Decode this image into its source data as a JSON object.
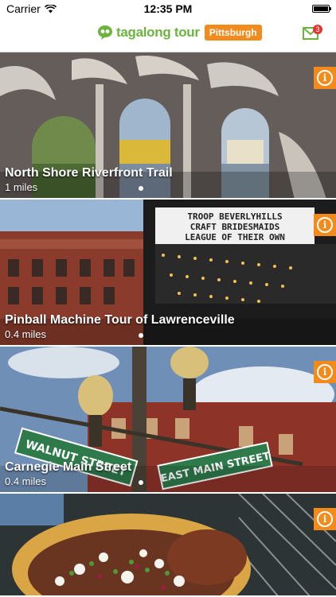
{
  "status_bar": {
    "carrier": "Carrier",
    "time": "12:35 PM",
    "battery_level": 1.0
  },
  "header": {
    "logo_text": "tagalong tour",
    "city": "Pittsburgh",
    "mail_count": "3"
  },
  "colors": {
    "brand_green": "#6cb43f",
    "accent_orange": "#f28a1c",
    "badge_red": "#e3342f"
  },
  "tours": [
    {
      "title": "North Shore Riverfront Trail",
      "distance": "1 miles",
      "info_icon": "info-icon"
    },
    {
      "title": "Pinball Machine Tour of Lawrenceville",
      "distance": "0.4 miles",
      "info_icon": "info-icon"
    },
    {
      "title": "Carnegie Main Street",
      "distance": "0.4 miles",
      "info_icon": "info-icon"
    },
    {
      "title": "",
      "distance": "",
      "info_icon": "info-icon"
    }
  ],
  "sign_text": {
    "marquee": [
      "TROOP BEVERLYHILLS",
      "CRAFT BRIDESMAIDS",
      "LEAGUE OF THEIR OWN"
    ],
    "street_left": "WALNUT STREET",
    "street_right": "EAST MAIN STREET"
  }
}
